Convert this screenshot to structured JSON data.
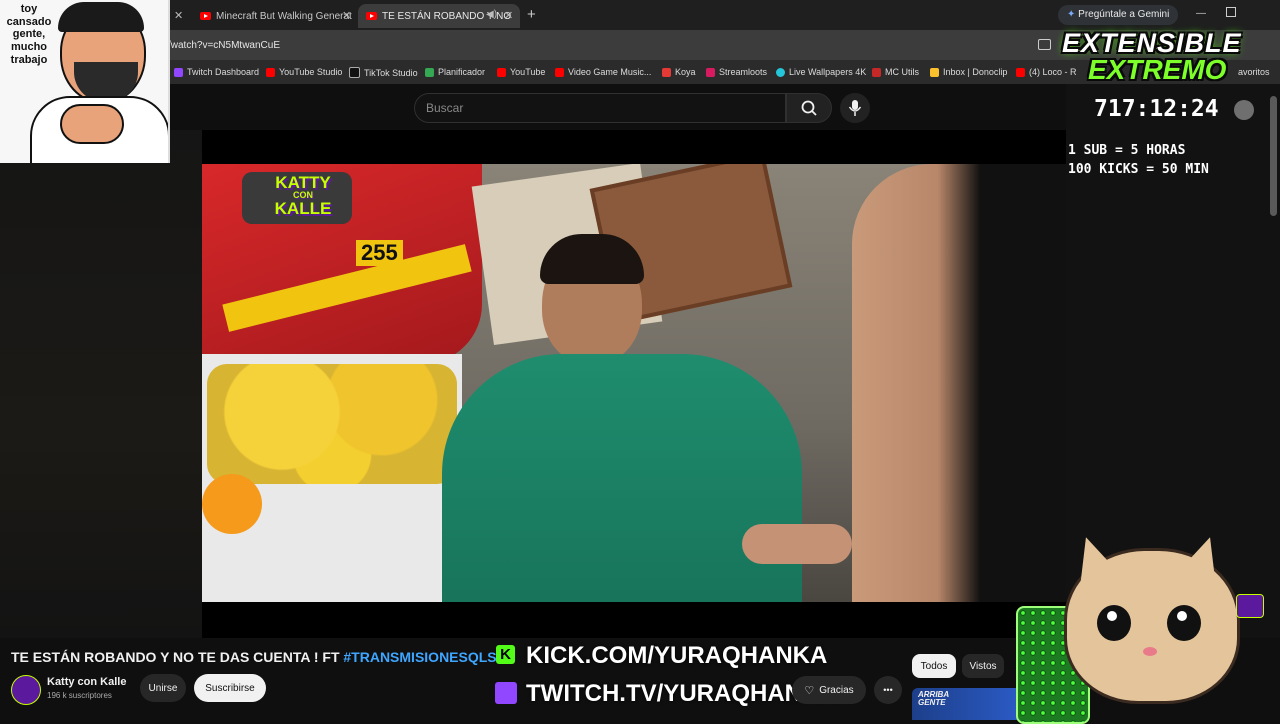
{
  "browser": {
    "tabs": [
      {
        "label": "Minecraft But Walking Generat"
      },
      {
        "label": "TE ESTÁN ROBANDO Y NO"
      }
    ],
    "new_tab": "+",
    "url": "/watch?v=cN5MtwanCuE",
    "gemini": "Pregúntale a Gemini",
    "bookmarks": [
      "Twitch Dashboard",
      "YouTube Studio",
      "TikTok Studio",
      "Planificador",
      "YouTube",
      "Video Game Music...",
      "Koya",
      "Streamloots",
      "Live Wallpapers 4K",
      "MC Utils",
      "Inbox | Donoclip",
      "(4) Loco - R",
      "avoritos"
    ]
  },
  "youtube": {
    "search_placeholder": "Buscar",
    "video_title": "TE ESTÁN ROBANDO Y NO TE DAS CUENTA ! FT",
    "hashtag": "#TRANSMISIONESQLS",
    "channel_name": "Katty con Kalle",
    "subscribers": "196 k suscriptores",
    "join_label": "Unirse",
    "subscribe_label": "Suscribirse",
    "thanks_label": "Gracias",
    "chips": [
      "Todos",
      "Vistos"
    ],
    "more": "•••",
    "thumb_text": "ARRIBA GENTE"
  },
  "video_overlay": {
    "brand_line1": "KATTY",
    "brand_line2": "CON",
    "brand_line3": "KALLE",
    "plate": "255"
  },
  "stream": {
    "webcam_caption": "toy cansado gente, mucho trabajo",
    "title_line1": "EXTENSIBLE",
    "title_line2": "EXTREMO",
    "timer": "717:12:24",
    "rule1": "1 SUB = 5 HORAS",
    "rule2": "100 KICKS = 50 MIN",
    "kick_url": "KICK.COM/YURAQHANKA",
    "twitch_url": "TWITCH.TV/YURAQHANKAA"
  },
  "colors": {
    "accent_red": "#ff0000",
    "hashtag_blue": "#3ea6ff",
    "kick_green": "#53fc18",
    "twitch_purple": "#9146ff"
  }
}
